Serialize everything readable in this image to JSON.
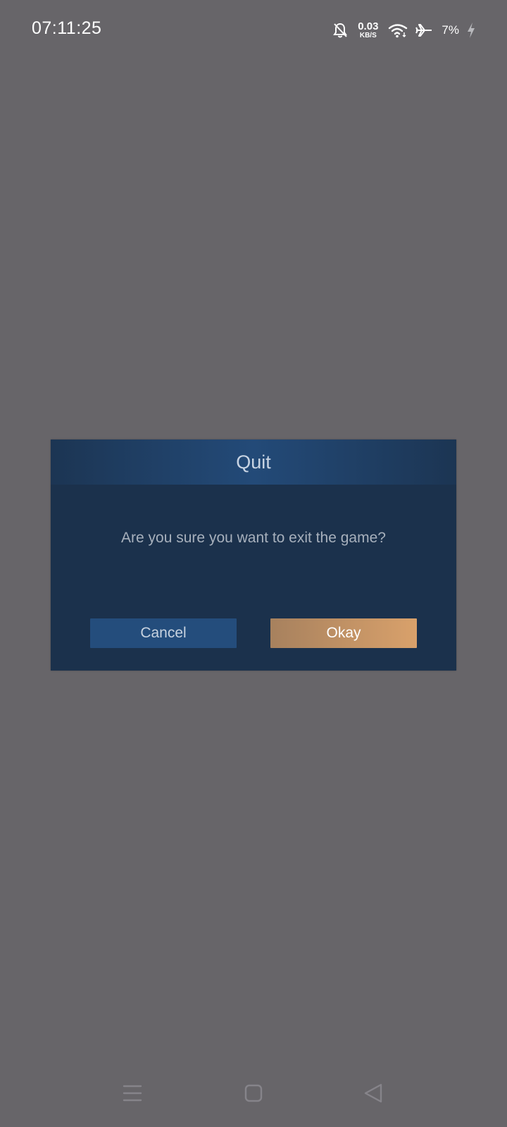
{
  "status_bar": {
    "time": "07:11:25",
    "net_speed_value": "0.03",
    "net_speed_unit": "KB/S",
    "battery_percent": "7%",
    "icons": [
      "bell-muted-icon",
      "wifi-icon",
      "airplane-icon",
      "charging-bolt-icon"
    ]
  },
  "dialog": {
    "title": "Quit",
    "message": "Are you sure you want to exit the game?",
    "cancel_label": "Cancel",
    "okay_label": "Okay"
  },
  "nav_bar": {
    "icons": [
      "menu-icon",
      "home-icon",
      "back-icon"
    ]
  },
  "colors": {
    "background": "#676569",
    "dialog_bg": "#1b314c",
    "header_accent": "#234a78",
    "cancel_button": "#244d7c",
    "okay_button_start": "#a7815e",
    "okay_button_end": "#d9a16b"
  }
}
